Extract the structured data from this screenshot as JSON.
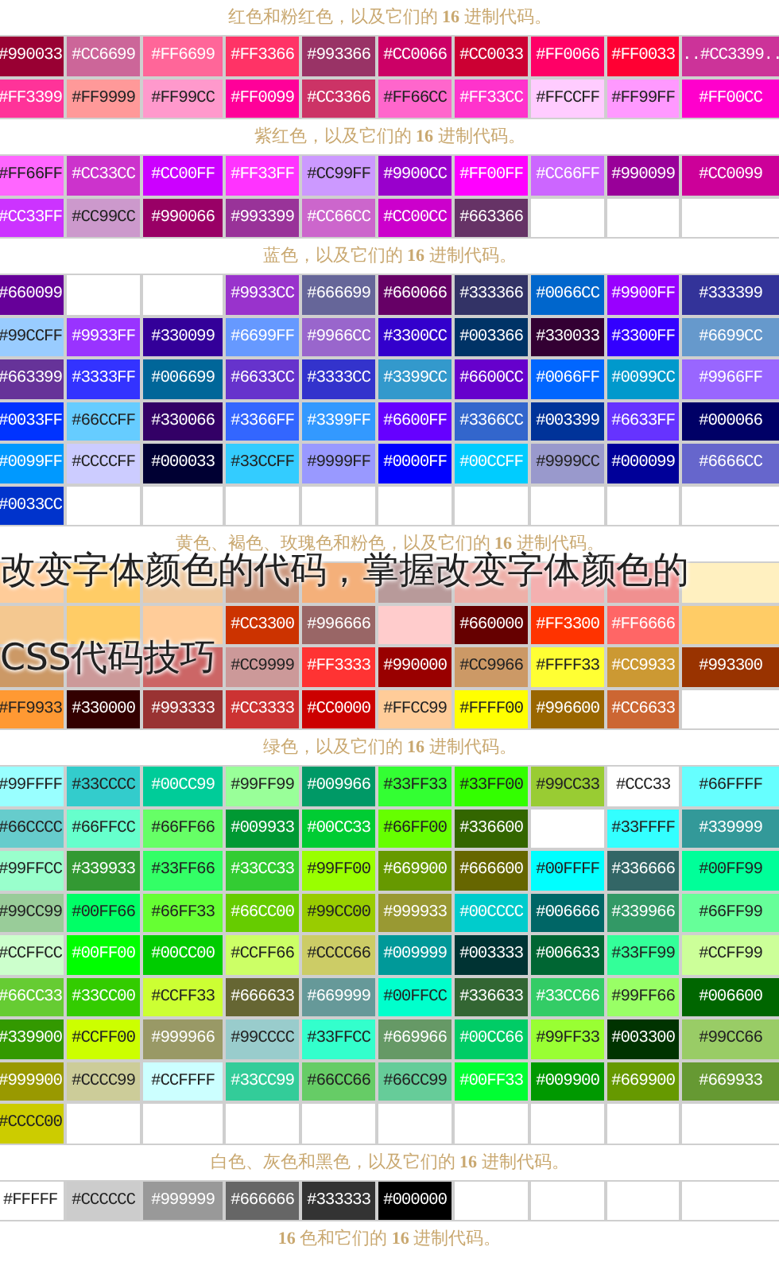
{
  "sections": [
    {
      "heading": "红色和粉红色，以及它们的 **16** 进制代码。",
      "rows": [
        [
          {
            "color": "#990033",
            "code": "#990033"
          },
          {
            "color": "#cc6699",
            "code": "#CC6699"
          },
          {
            "color": "#ff6699",
            "code": "#FF6699"
          },
          {
            "color": "#ff3366",
            "code": "#FF3366"
          },
          {
            "color": "#993366",
            "code": "#993366"
          },
          {
            "color": "#cc0066",
            "code": "#CC0066"
          },
          {
            "color": "#cc0033",
            "code": "#CC0033"
          },
          {
            "color": "#ff0066",
            "code": "#FF0066"
          },
          {
            "color": "#ff0033",
            "code": "#FF0033"
          },
          {
            "color": "#cc3399",
            "code": "..#CC3399.."
          }
        ],
        [
          {
            "color": "#ff3399",
            "code": "#FF3399"
          },
          {
            "color": "#ff9999",
            "code": "#FF9999"
          },
          {
            "color": "#ff99cc",
            "code": "#FF99CC"
          },
          {
            "color": "#ff0099",
            "code": "#FF0099"
          },
          {
            "color": "#cc3366",
            "code": "#CC3366"
          },
          {
            "color": "#ff66cc",
            "code": "#FF66CC"
          },
          {
            "color": "#ff33cc",
            "code": "#FF33CC"
          },
          {
            "color": "#ffccff",
            "code": "#FFCCFF"
          },
          {
            "color": "#ff99ff",
            "code": "#FF99FF"
          },
          {
            "color": "#ff00cc",
            "code": "#FF00CC"
          }
        ]
      ]
    },
    {
      "heading": "紫红色，以及它们的 **16** 进制代码。",
      "rows": [
        [
          {
            "color": "#ff66ff",
            "code": "#FF66FF"
          },
          {
            "color": "#cc33cc",
            "code": "#CC33CC"
          },
          {
            "color": "#cc00ff",
            "code": "#CC00FF"
          },
          {
            "color": "#ff33ff",
            "code": "#FF33FF"
          },
          {
            "color": "#cc99ff",
            "code": "#CC99FF"
          },
          {
            "color": "#9900cc",
            "code": "#9900CC"
          },
          {
            "color": "#ff00ff",
            "code": "#FF00FF"
          },
          {
            "color": "#cc66ff",
            "code": "#CC66FF"
          },
          {
            "color": "#990099",
            "code": "#990099"
          },
          {
            "color": "#cc0099",
            "code": "#CC0099"
          }
        ],
        [
          {
            "color": "#cc33ff",
            "code": "#CC33FF"
          },
          {
            "color": "#cc99cc",
            "code": "#CC99CC"
          },
          {
            "color": "#990066",
            "code": "#990066"
          },
          {
            "color": "#993399",
            "code": "#993399"
          },
          {
            "color": "#cc66cc",
            "code": "#CC66CC"
          },
          {
            "color": "#cc00cc",
            "code": "#CC00CC"
          },
          {
            "color": "#663366",
            "code": "#663366"
          },
          {
            "color": "#ffffff"
          },
          {
            "color": "#ffffff"
          },
          {
            "color": "#ffffff"
          }
        ]
      ]
    },
    {
      "heading": "蓝色，以及它们的 **16** 进制代码。",
      "rows": [
        [
          {
            "color": "#660099",
            "code": "#660099"
          },
          {
            "color": "#ffffff"
          },
          {
            "color": "#ffffff"
          },
          {
            "color": "#9933cc",
            "code": "#9933CC"
          },
          {
            "color": "#666699",
            "code": "#666699"
          },
          {
            "color": "#660066",
            "code": "#660066"
          },
          {
            "color": "#333366",
            "code": "#333366"
          },
          {
            "color": "#0066cc",
            "code": "#0066CC"
          },
          {
            "color": "#9900ff",
            "code": "#9900FF"
          },
          {
            "color": "#333399",
            "code": "#333399"
          }
        ],
        [
          {
            "color": "#99ccff",
            "code": "#99CCFF"
          },
          {
            "color": "#9933ff",
            "code": "#9933FF"
          },
          {
            "color": "#330099",
            "code": "#330099"
          },
          {
            "color": "#6699ff",
            "code": "#6699FF"
          },
          {
            "color": "#9966cc",
            "code": "#9966CC"
          },
          {
            "color": "#3300cc",
            "code": "#3300CC"
          },
          {
            "color": "#003366",
            "code": "#003366"
          },
          {
            "color": "#330033",
            "code": "#330033"
          },
          {
            "color": "#3300ff",
            "code": "#3300FF"
          },
          {
            "color": "#6699cc",
            "code": "#6699CC"
          }
        ],
        [
          {
            "color": "#663399",
            "code": "#663399"
          },
          {
            "color": "#3333ff",
            "code": "#3333FF"
          },
          {
            "color": "#006699",
            "code": "#006699"
          },
          {
            "color": "#6633cc",
            "code": "#6633CC"
          },
          {
            "color": "#3333cc",
            "code": "#3333CC"
          },
          {
            "color": "#3399cc",
            "code": "#3399CC"
          },
          {
            "color": "#6600cc",
            "code": "#6600CC"
          },
          {
            "color": "#0066ff",
            "code": "#0066FF"
          },
          {
            "color": "#0099cc",
            "code": "#0099CC"
          },
          {
            "color": "#9966ff",
            "code": "#9966FF"
          }
        ],
        [
          {
            "color": "#0033ff",
            "code": "#0033FF"
          },
          {
            "color": "#66ccff",
            "code": "#66CCFF"
          },
          {
            "color": "#330066",
            "code": "#330066"
          },
          {
            "color": "#3366ff",
            "code": "#3366FF"
          },
          {
            "color": "#3399ff",
            "code": "#3399FF"
          },
          {
            "color": "#6600ff",
            "code": "#6600FF"
          },
          {
            "color": "#3366cc",
            "code": "#3366CC"
          },
          {
            "color": "#003399",
            "code": "#003399"
          },
          {
            "color": "#6633ff",
            "code": "#6633FF"
          },
          {
            "color": "#000066",
            "code": "#000066"
          }
        ],
        [
          {
            "color": "#0099ff",
            "code": "#0099FF"
          },
          {
            "color": "#ccccff",
            "code": "#CCCCFF"
          },
          {
            "color": "#000033",
            "code": "#000033"
          },
          {
            "color": "#33ccff",
            "code": "#33CCFF"
          },
          {
            "color": "#9999ff",
            "code": "#9999FF"
          },
          {
            "color": "#0000ff",
            "code": "#0000FF"
          },
          {
            "color": "#00ccff",
            "code": "#00CCFF"
          },
          {
            "color": "#9999cc",
            "code": "#9999CC"
          },
          {
            "color": "#000099",
            "code": "#000099"
          },
          {
            "color": "#6666cc",
            "code": "#6666CC"
          }
        ],
        [
          {
            "color": "#0033cc",
            "code": "#0033CC"
          },
          {
            "color": "#ffffff"
          },
          {
            "color": "#ffffff"
          },
          {
            "color": "#ffffff"
          },
          {
            "color": "#ffffff"
          },
          {
            "color": "#ffffff"
          },
          {
            "color": "#ffffff"
          },
          {
            "color": "#ffffff"
          },
          {
            "color": "#ffffff"
          },
          {
            "color": "#ffffff"
          }
        ]
      ]
    },
    {
      "heading": "黄色、褐色、玫瑰色和粉色，以及它们的 **16** 进制代码。",
      "rows": [
        [
          {
            "color": "#ffcc99"
          },
          {
            "color": "#ffcc66"
          },
          {
            "color": "#eec9a0"
          },
          {
            "color": "#cc9980"
          },
          {
            "color": "#f4b07a"
          },
          {
            "color": "#b89a9a"
          },
          {
            "color": "#eeb0a8"
          },
          {
            "color": "#f4b0b0"
          },
          {
            "color": "#f09090"
          },
          {
            "color": "#fff0c0"
          }
        ],
        [
          {
            "color": "#f4c890"
          },
          {
            "color": "#ffcc66"
          },
          {
            "color": "#ffcc99"
          },
          {
            "color": "#cc3300",
            "code": "#CC3300"
          },
          {
            "color": "#996666",
            "code": "#996666"
          },
          {
            "color": "#ffcccc"
          },
          {
            "color": "#660000",
            "code": "#660000"
          },
          {
            "color": "#ff3300",
            "code": "#FF3300"
          },
          {
            "color": "#ff6666",
            "code": "#FF6666"
          },
          {
            "color": "#ffcc66"
          }
        ],
        [
          {
            "color": "#cc9966"
          },
          {
            "color": "#cc9999"
          },
          {
            "color": "#cc6666"
          },
          {
            "color": "#cc9999",
            "code": "#CC9999"
          },
          {
            "color": "#ff3333",
            "code": "#FF3333"
          },
          {
            "color": "#990000",
            "code": "#990000"
          },
          {
            "color": "#cc9966",
            "code": "#CC9966"
          },
          {
            "color": "#ffff33",
            "code": "#FFFF33"
          },
          {
            "color": "#cc9933",
            "code": "#CC9933"
          },
          {
            "color": "#993300",
            "code": "#993300"
          }
        ],
        [
          {
            "color": "#ff9933",
            "code": "#FF9933"
          },
          {
            "color": "#330000",
            "code": "#330000"
          },
          {
            "color": "#993333",
            "code": "#993333"
          },
          {
            "color": "#cc3333",
            "code": "#CC3333"
          },
          {
            "color": "#cc0000",
            "code": "#CC0000"
          },
          {
            "color": "#ffcc99",
            "code": "#FFCC99"
          },
          {
            "color": "#ffff00",
            "code": "#FFFF00"
          },
          {
            "color": "#996600",
            "code": "#996600"
          },
          {
            "color": "#cc6633",
            "code": "#CC6633"
          },
          {
            "color": "#ffffff"
          }
        ]
      ]
    },
    {
      "heading": "绿色，以及它们的 **16** 进制代码。",
      "rows": [
        [
          {
            "color": "#99ffff",
            "code": "#99FFFF"
          },
          {
            "color": "#33cccc",
            "code": "#33CCCC"
          },
          {
            "color": "#00cc99",
            "code": "#00CC99"
          },
          {
            "color": "#99ff99",
            "code": "#99FF99"
          },
          {
            "color": "#009966",
            "code": "#009966"
          },
          {
            "color": "#33ff33",
            "code": "#33FF33"
          },
          {
            "color": "#33ff00",
            "code": "#33FF00"
          },
          {
            "color": "#99cc33",
            "code": "#99CC33"
          },
          {
            "color": "#ffffff",
            "code": "#CCC33"
          },
          {
            "color": "#66ffff",
            "code": "#66FFFF"
          }
        ],
        [
          {
            "color": "#66cccc",
            "code": "#66CCCC"
          },
          {
            "color": "#66ffcc",
            "code": "#66FFCC"
          },
          {
            "color": "#66ff66",
            "code": "#66FF66"
          },
          {
            "color": "#009933",
            "code": "#009933"
          },
          {
            "color": "#00cc33",
            "code": "#00CC33"
          },
          {
            "color": "#66ff00",
            "code": "#66FF00"
          },
          {
            "color": "#336600",
            "code": "#336600"
          },
          {
            "color": "#ffffff"
          },
          {
            "color": "#33ffff",
            "code": "#33FFFF"
          },
          {
            "color": "#339999",
            "code": "#339999"
          }
        ],
        [
          {
            "color": "#99ffcc",
            "code": "#99FFCC"
          },
          {
            "color": "#339933",
            "code": "#339933"
          },
          {
            "color": "#33ff66",
            "code": "#33FF66"
          },
          {
            "color": "#33cc33",
            "code": "#33CC33"
          },
          {
            "color": "#99ff00",
            "code": "#99FF00"
          },
          {
            "color": "#669900",
            "code": "#669900"
          },
          {
            "color": "#666600",
            "code": "#666600"
          },
          {
            "color": "#00ffff",
            "code": "#00FFFF"
          },
          {
            "color": "#336666",
            "code": "#336666"
          },
          {
            "color": "#00ff99",
            "code": "#00FF99"
          }
        ],
        [
          {
            "color": "#99cc99",
            "code": "#99CC99"
          },
          {
            "color": "#00ff66",
            "code": "#00FF66"
          },
          {
            "color": "#66ff33",
            "code": "#66FF33"
          },
          {
            "color": "#66cc00",
            "code": "#66CC00"
          },
          {
            "color": "#99cc00",
            "code": "#99CC00"
          },
          {
            "color": "#999933",
            "code": "#999933"
          },
          {
            "color": "#00cccc",
            "code": "#00CCCC"
          },
          {
            "color": "#006666",
            "code": "#006666"
          },
          {
            "color": "#339966",
            "code": "#339966"
          },
          {
            "color": "#66ff99",
            "code": "#66FF99"
          }
        ],
        [
          {
            "color": "#ccffcc",
            "code": "#CCFFCC"
          },
          {
            "color": "#00ff00",
            "code": "#00FF00"
          },
          {
            "color": "#00cc00",
            "code": "#00CC00"
          },
          {
            "color": "#ccff66",
            "code": "#CCFF66"
          },
          {
            "color": "#cccc66",
            "code": "#CCCC66"
          },
          {
            "color": "#009999",
            "code": "#009999"
          },
          {
            "color": "#003333",
            "code": "#003333"
          },
          {
            "color": "#006633",
            "code": "#006633"
          },
          {
            "color": "#33ff99",
            "code": "#33FF99"
          },
          {
            "color": "#ccff99",
            "code": "#CCFF99"
          }
        ],
        [
          {
            "color": "#66cc33",
            "code": "#66CC33"
          },
          {
            "color": "#33cc00",
            "code": "#33CC00"
          },
          {
            "color": "#ccff33",
            "code": "#CCFF33"
          },
          {
            "color": "#666633",
            "code": "#666633"
          },
          {
            "color": "#669999",
            "code": "#669999"
          },
          {
            "color": "#00ffcc",
            "code": "#00FFCC"
          },
          {
            "color": "#336633",
            "code": "#336633"
          },
          {
            "color": "#33cc66",
            "code": "#33CC66"
          },
          {
            "color": "#99ff66",
            "code": "#99FF66"
          },
          {
            "color": "#006600",
            "code": "#006600"
          }
        ],
        [
          {
            "color": "#339900",
            "code": "#339900"
          },
          {
            "color": "#ccff00",
            "code": "#CCFF00"
          },
          {
            "color": "#999966",
            "code": "#999966"
          },
          {
            "color": "#99cccc",
            "code": "#99CCCC"
          },
          {
            "color": "#33ffcc",
            "code": "#33FFCC"
          },
          {
            "color": "#669966",
            "code": "#669966"
          },
          {
            "color": "#00cc66",
            "code": "#00CC66"
          },
          {
            "color": "#99ff33",
            "code": "#99FF33"
          },
          {
            "color": "#003300",
            "code": "#003300"
          },
          {
            "color": "#99cc66",
            "code": "#99CC66"
          }
        ],
        [
          {
            "color": "#999900",
            "code": "#999900"
          },
          {
            "color": "#cccc99",
            "code": "#CCCC99"
          },
          {
            "color": "#ccffff",
            "code": "#CCFFFF"
          },
          {
            "color": "#33cc99",
            "code": "#33CC99"
          },
          {
            "color": "#66cc66",
            "code": "#66CC66"
          },
          {
            "color": "#66cc99",
            "code": "#66CC99"
          },
          {
            "color": "#00ff33",
            "code": "#00FF33"
          },
          {
            "color": "#009900",
            "code": "#009900"
          },
          {
            "color": "#669900",
            "code": "#669900"
          },
          {
            "color": "#669933",
            "code": "#669933"
          }
        ],
        [
          {
            "color": "#cccc00",
            "code": "#CCCC00"
          },
          {
            "color": "#ffffff"
          },
          {
            "color": "#ffffff"
          },
          {
            "color": "#ffffff"
          },
          {
            "color": "#ffffff"
          },
          {
            "color": "#ffffff"
          },
          {
            "color": "#ffffff"
          },
          {
            "color": "#ffffff"
          },
          {
            "color": "#ffffff"
          },
          {
            "color": "#ffffff"
          }
        ]
      ]
    },
    {
      "heading": "白色、灰色和黑色，以及它们的 **16** 进制代码。",
      "rows": [
        [
          {
            "color": "#ffffff",
            "code": "#FFFFF"
          },
          {
            "color": "#cccccc",
            "code": "#CCCCCC"
          },
          {
            "color": "#999999",
            "code": "#999999"
          },
          {
            "color": "#666666",
            "code": "#666666"
          },
          {
            "color": "#333333",
            "code": "#333333"
          },
          {
            "color": "#000000",
            "code": "#000000"
          },
          {
            "color": "#ffffff"
          },
          {
            "color": "#ffffff"
          },
          {
            "color": "#ffffff"
          },
          {
            "color": "#ffffff"
          }
        ]
      ]
    },
    {
      "heading": "**16** 色和它们的 **16** 进制代码。"
    }
  ],
  "caption": {
    "lines": [
      "改变字体颜色的代码，掌握改变字体颜色的",
      "CSS代码技巧"
    ]
  }
}
